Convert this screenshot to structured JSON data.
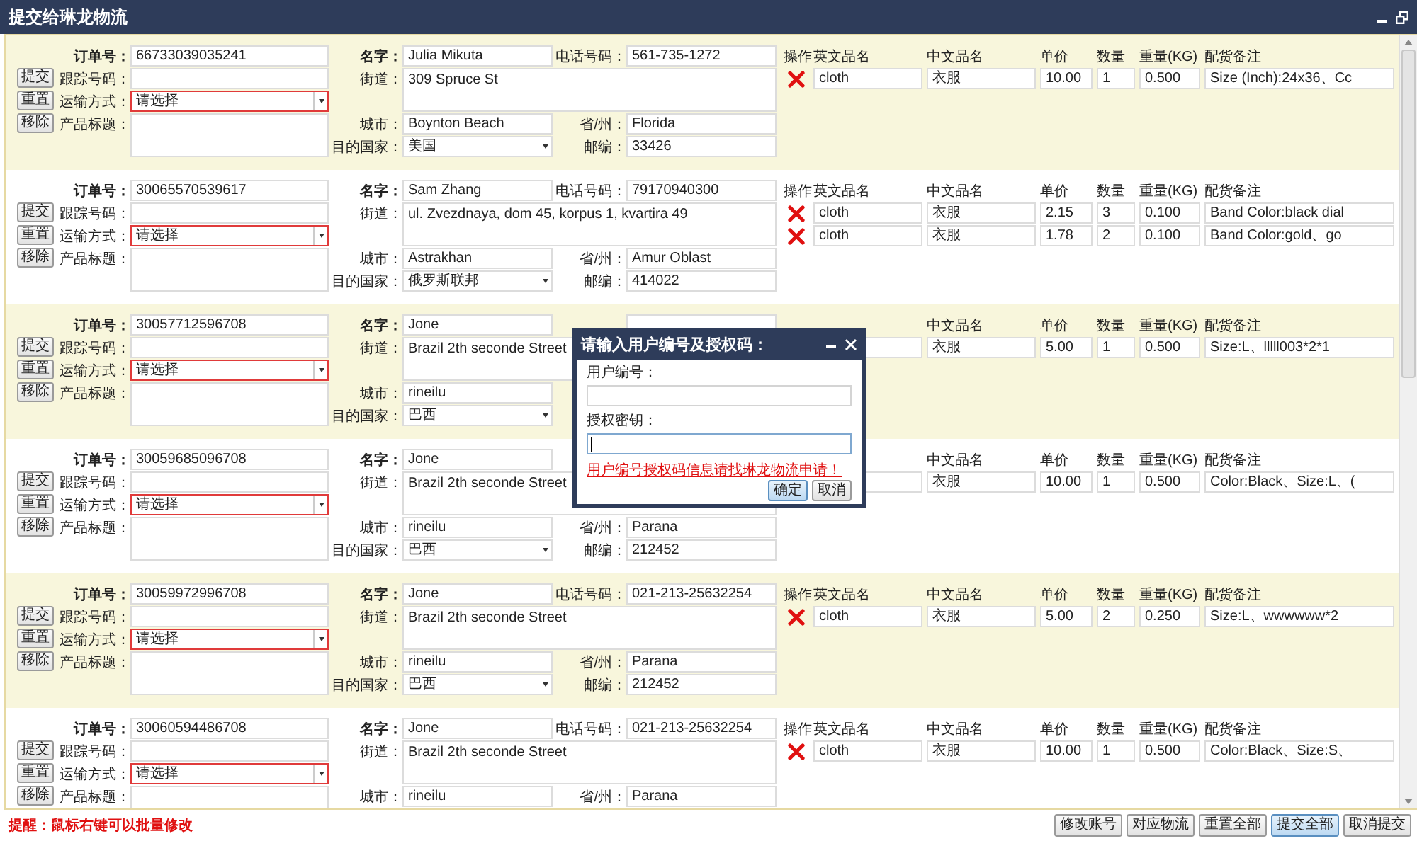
{
  "window": {
    "title": "提交给琳龙物流"
  },
  "orders": [
    {
      "labels": {
        "order_no": "订单号：",
        "tracking_no": "跟踪号码：",
        "shipping": "运输方式：",
        "product_title": "产品标题：",
        "name": "名字：",
        "phone": "电话号码：",
        "street": "街道：",
        "city": "城市：",
        "province": "省/州：",
        "country": "目的国家：",
        "zip": "邮编："
      },
      "buttons": [
        "提交",
        "重置",
        "移除"
      ],
      "order_no": "66733039035241",
      "shipping": "请选择",
      "name": "Julia Mikuta",
      "phone": "561-735-1272",
      "street": "309 Spruce St",
      "city": "Boynton Beach",
      "province": "Florida",
      "country": "美国",
      "zip": "33426",
      "item_header": [
        "操作",
        "英文品名",
        "中文品名",
        "单价",
        "数量",
        "重量(KG)",
        "配货备注"
      ],
      "items": [
        {
          "en": "cloth",
          "cn": "衣服",
          "price": "10.00",
          "qty": "1",
          "weight": "0.500",
          "note": "Size (Inch):24x36、Cc"
        }
      ]
    },
    {
      "labels": {
        "order_no": "订单号：",
        "tracking_no": "跟踪号码：",
        "shipping": "运输方式：",
        "product_title": "产品标题：",
        "name": "名字：",
        "phone": "电话号码：",
        "street": "街道：",
        "city": "城市：",
        "province": "省/州：",
        "country": "目的国家：",
        "zip": "邮编："
      },
      "buttons": [
        "提交",
        "重置",
        "移除"
      ],
      "order_no": "30065570539617",
      "shipping": "请选择",
      "name": "Sam Zhang",
      "phone": "79170940300",
      "street": "ul. Zvezdnaya, dom 45, korpus 1, kvartira 49",
      "city": "Astrakhan",
      "province": "Amur Oblast",
      "country": "俄罗斯联邦",
      "zip": "414022",
      "item_header": [
        "操作",
        "英文品名",
        "中文品名",
        "单价",
        "数量",
        "重量(KG)",
        "配货备注"
      ],
      "items": [
        {
          "en": "cloth",
          "cn": "衣服",
          "price": "2.15",
          "qty": "3",
          "weight": "0.100",
          "note": "Band Color:black dial"
        },
        {
          "en": "cloth",
          "cn": "衣服",
          "price": "1.78",
          "qty": "2",
          "weight": "0.100",
          "note": "Band Color:gold、go"
        }
      ]
    },
    {
      "labels": {
        "order_no": "订单号：",
        "tracking_no": "跟踪号码：",
        "shipping": "运输方式：",
        "product_title": "产品标题：",
        "name": "名字：",
        "street": "街道：",
        "city": "城市：",
        "country": "目的国家："
      },
      "buttons": [
        "提交",
        "重置",
        "移除"
      ],
      "order_no": "30057712596708",
      "shipping": "请选择",
      "name": "Jone",
      "street": "Brazil  2th seconde Street",
      "city": "rineilu",
      "country": "巴西",
      "item_header": [
        "中文品名",
        "单价",
        "数量",
        "重量(KG)",
        "配货备注"
      ],
      "items": [
        {
          "cn": "衣服",
          "price": "5.00",
          "qty": "1",
          "weight": "0.500",
          "note": "Size:L、lllll003*2*1"
        }
      ]
    },
    {
      "labels": {
        "order_no": "订单号：",
        "tracking_no": "跟踪号码：",
        "shipping": "运输方式：",
        "product_title": "产品标题：",
        "name": "名字：",
        "street": "街道：",
        "city": "城市：",
        "province": "省/州：",
        "country": "目的国家：",
        "zip": "邮编："
      },
      "buttons": [
        "提交",
        "重置",
        "移除"
      ],
      "order_no": "30059685096708",
      "shipping": "请选择",
      "name": "Jone",
      "street": "Brazil  2th seconde Street",
      "city": "rineilu",
      "province": "Parana",
      "country": "巴西",
      "zip": "212452",
      "item_header": [
        "中文品名",
        "单价",
        "数量",
        "重量(KG)",
        "配货备注"
      ],
      "items": [
        {
          "cn": "衣服",
          "price": "10.00",
          "qty": "1",
          "weight": "0.500",
          "note": "Color:Black、Size:L、("
        }
      ]
    },
    {
      "labels": {
        "order_no": "订单号：",
        "tracking_no": "跟踪号码：",
        "shipping": "运输方式：",
        "product_title": "产品标题：",
        "name": "名字：",
        "phone": "电话号码：",
        "street": "街道：",
        "city": "城市：",
        "province": "省/州：",
        "country": "目的国家：",
        "zip": "邮编："
      },
      "buttons": [
        "提交",
        "重置",
        "移除"
      ],
      "order_no": "30059972996708",
      "shipping": "请选择",
      "name": "Jone",
      "phone": "021-213-25632254",
      "street": "Brazil  2th seconde Street",
      "city": "rineilu",
      "province": "Parana",
      "country": "巴西",
      "zip": "212452",
      "item_header": [
        "操作",
        "英文品名",
        "中文品名",
        "单价",
        "数量",
        "重量(KG)",
        "配货备注"
      ],
      "items": [
        {
          "en": "cloth",
          "cn": "衣服",
          "price": "5.00",
          "qty": "2",
          "weight": "0.250",
          "note": "Size:L、wwwwww*2"
        }
      ]
    },
    {
      "labels": {
        "order_no": "订单号：",
        "tracking_no": "跟踪号码：",
        "shipping": "运输方式：",
        "product_title": "产品标题：",
        "name": "名字：",
        "phone": "电话号码：",
        "street": "街道：",
        "city": "城市：",
        "province": "省/州："
      },
      "buttons": [
        "提交",
        "重置",
        "移除"
      ],
      "order_no": "30060594486708",
      "shipping": "请选择",
      "name": "Jone",
      "phone": "021-213-25632254",
      "street": "Brazil  2th seconde Street",
      "city": "rineilu",
      "province": "Parana",
      "item_header": [
        "操作",
        "英文品名",
        "中文品名",
        "单价",
        "数量",
        "重量(KG)",
        "配货备注"
      ],
      "items": [
        {
          "en": "cloth",
          "cn": "衣服",
          "price": "10.00",
          "qty": "1",
          "weight": "0.500",
          "note": "Color:Black、Size:S、"
        }
      ]
    }
  ],
  "dialog": {
    "title": "请输入用户编号及授权码：",
    "user_label": "用户编号：",
    "key_label": "授权密钥：",
    "link": "用户编号授权码信息请找琳龙物流申请！",
    "buttons": [
      {
        "label": "确定",
        "primary": true
      },
      {
        "label": "取消",
        "primary": false
      }
    ]
  },
  "footer": {
    "hint": "提醒：鼠标右键可以批量修改",
    "buttons": [
      {
        "label": "修改账号",
        "primary": false
      },
      {
        "label": "对应物流",
        "primary": false
      },
      {
        "label": "重置全部",
        "primary": false
      },
      {
        "label": "提交全部",
        "primary": true
      },
      {
        "label": "取消提交",
        "primary": false
      }
    ]
  }
}
